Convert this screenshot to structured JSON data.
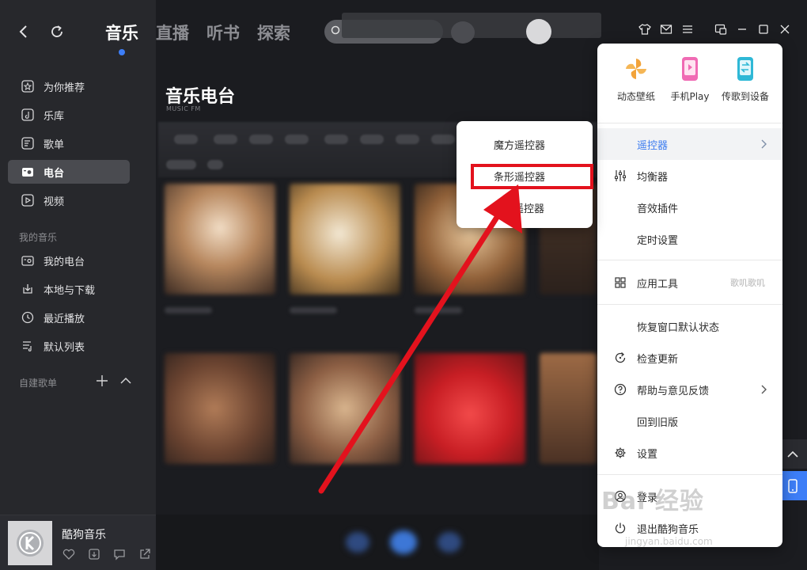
{
  "topbar": {
    "tabs": [
      {
        "label": "音乐",
        "active": true
      },
      {
        "label": "直播",
        "active": false
      },
      {
        "label": "听书",
        "active": false
      },
      {
        "label": "探索",
        "active": false
      }
    ],
    "search_placeholder": ""
  },
  "sidebar": {
    "items": [
      {
        "label": "为你推荐",
        "icon": "star-icon"
      },
      {
        "label": "乐库",
        "icon": "music-library-icon"
      },
      {
        "label": "歌单",
        "icon": "playlist-icon"
      },
      {
        "label": "电台",
        "icon": "radio-icon",
        "active": true
      },
      {
        "label": "视频",
        "icon": "video-icon"
      }
    ],
    "my_music_label": "我的音乐",
    "my_items": [
      {
        "label": "我的电台",
        "icon": "my-radio-icon"
      },
      {
        "label": "本地与下载",
        "icon": "download-icon"
      },
      {
        "label": "最近播放",
        "icon": "clock-icon"
      },
      {
        "label": "默认列表",
        "icon": "list-icon"
      }
    ],
    "created_label": "自建歌单"
  },
  "player": {
    "song": "酷狗音乐"
  },
  "main": {
    "title": "音乐电台",
    "subtitle": "MUSIC FM"
  },
  "main_menu": {
    "quick_actions": [
      {
        "label": "动态壁纸",
        "icon": "pinwheel-icon",
        "color": "#f2a33a"
      },
      {
        "label": "手机Play",
        "icon": "phone-play-icon",
        "color": "#f06bb4"
      },
      {
        "label": "传歌到设备",
        "icon": "transfer-device-icon",
        "color": "#2fb8d6"
      }
    ],
    "items": [
      {
        "label": "遥控器",
        "highlight": true
      },
      {
        "label": "均衡器",
        "icon": "equalizer-icon"
      },
      {
        "label": "音效插件"
      },
      {
        "label": "定时设置"
      },
      {
        "label": "应用工具",
        "icon": "apps-icon",
        "hint": "歌叽歌叽"
      },
      {
        "label": "恢复窗口默认状态"
      },
      {
        "label": "检查更新",
        "icon": "update-icon"
      },
      {
        "label": "帮助与意见反馈",
        "icon": "help-icon"
      },
      {
        "label": "回到旧版"
      },
      {
        "label": "设置",
        "icon": "gear-icon"
      },
      {
        "label": "登录",
        "icon": "user-icon"
      },
      {
        "label": "退出酷狗音乐",
        "icon": "power-icon"
      }
    ]
  },
  "submenu": {
    "items": [
      {
        "label": "魔方遥控器"
      },
      {
        "label": "条形遥控器",
        "highlighted": true
      },
      {
        "label": "遥控器"
      }
    ]
  },
  "watermark": {
    "text": "Bai 经验",
    "sub": "jingyan.baidu.com"
  }
}
